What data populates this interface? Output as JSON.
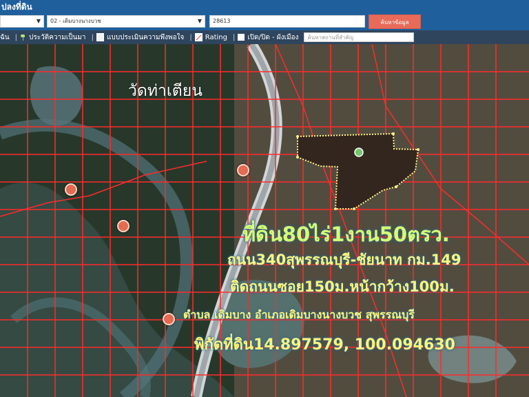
{
  "header": {
    "title": "ปลงที่ดิน",
    "selects": [
      "",
      "02 - เดิมบางนางบวช"
    ],
    "parcel_value": "28613",
    "search_button": "ค้นหาข้อมูล"
  },
  "toolbar": {
    "items": [
      "ฉัน",
      "ประวัติความเป็นมา",
      "แบบประเมินความพึงพอใจ",
      "Rating",
      "เปิด/ปิด - ผังเมือง"
    ],
    "search_placeholder": "ค้นหาสถานที่สำคัญ"
  },
  "map": {
    "label": "วัดท่าเตียน",
    "overlay_lines": [
      "ที่ดิน80ไร่1งาน50ตรว.",
      "ถนน340สุพรรณบุรี-ชัยนาท กม.149",
      "ติดถนนซอย150ม.หน้ากว้าง100ม.",
      "ตำบล เดิมบาง อำเภอเดิมบางนางบวช สุพรรณบุรี",
      "พิกัดที่ดิน14.897579, 100.094630"
    ]
  },
  "icons": {
    "sprout": "sprout-icon",
    "doc": "document-icon",
    "chart": "chart-icon",
    "checkbox": "checkbox-icon",
    "pin": "map-pin-icon"
  },
  "colors": {
    "header_bg": "#1f5f9c",
    "toolbar_bg": "#2f455e",
    "search_btn": "#e86b5a",
    "parcel_outline": "#ff2b2b",
    "highlight_outline": "#fff48a",
    "overlay_text": "#fff47a"
  }
}
